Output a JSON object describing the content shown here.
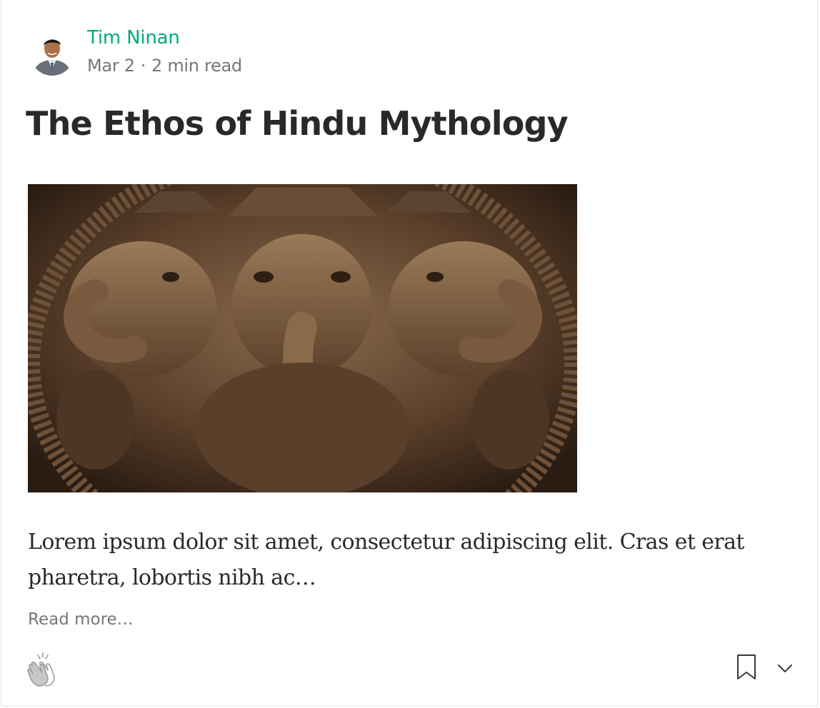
{
  "post": {
    "author": "Tim Ninan",
    "date": "Mar 2",
    "separator": "·",
    "read_time": "2 min read",
    "title": "The Ethos of Hindu Mythology",
    "excerpt": "Lorem ipsum dolor sit amet, consectetur adipiscing elit. Cras et erat pharetra, lobortis nibh ac…",
    "read_more": "Read more…"
  },
  "icons": {
    "clap": "clap-icon",
    "bookmark": "bookmark-icon",
    "more": "chevron-down-icon"
  },
  "colors": {
    "accent": "#03a87c",
    "text": "#292929",
    "muted": "#757575"
  }
}
